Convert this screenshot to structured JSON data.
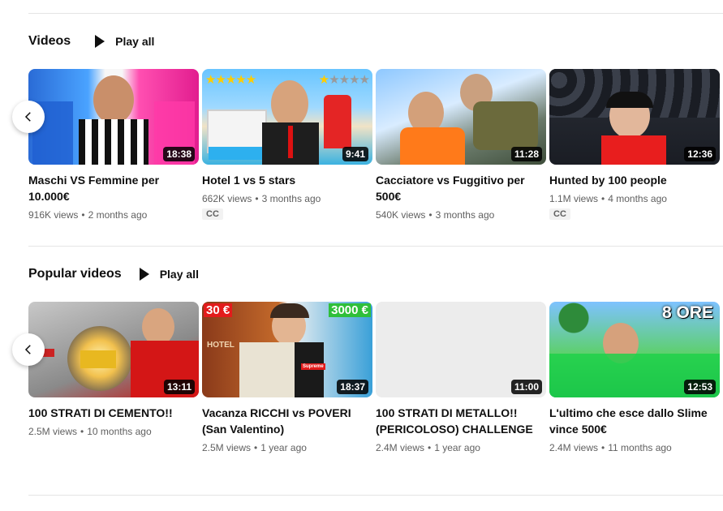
{
  "shelves": [
    {
      "title": "Videos",
      "play_all": "Play all",
      "videos": [
        {
          "title_line1": "Maschi VS Femmine per",
          "title_line2": "10.000€",
          "views": "916K views",
          "age": "2 months ago",
          "duration": "18:38",
          "cc": ""
        },
        {
          "title_line1": "Hotel 1 vs 5 stars",
          "title_line2": "",
          "views": "662K views",
          "age": "3 months ago",
          "duration": "9:41",
          "cc": "CC"
        },
        {
          "title_line1": "Cacciatore vs Fuggitivo per",
          "title_line2": "500€",
          "views": "540K views",
          "age": "3 months ago",
          "duration": "11:28",
          "cc": ""
        },
        {
          "title_line1": "Hunted by 100 people",
          "title_line2": "",
          "views": "1.1M views",
          "age": "4 months ago",
          "duration": "12:36",
          "cc": "CC"
        }
      ]
    },
    {
      "title": "Popular videos",
      "play_all": "Play all",
      "videos": [
        {
          "title_line1": "100 STRATI DI CEMENTO!!",
          "title_line2": "",
          "views": "2.5M views",
          "age": "10 months ago",
          "duration": "13:11",
          "cc": ""
        },
        {
          "title_line1": "Vacanza RICCHI vs POVERI",
          "title_line2": "(San Valentino)",
          "views": "2.5M views",
          "age": "1 year ago",
          "duration": "18:37",
          "cc": ""
        },
        {
          "title_line1": "100 STRATI DI METALLO!!",
          "title_line2": "(PERICOLOSO) CHALLENGE",
          "views": "2.4M views",
          "age": "1 year ago",
          "duration": "11:00",
          "cc": ""
        },
        {
          "title_line1": "L'ultimo che esce dallo Slime",
          "title_line2": "vince 500€",
          "views": "2.4M views",
          "age": "11 months ago",
          "duration": "12:53",
          "cc": ""
        }
      ]
    }
  ],
  "thumb_text": {
    "price_low": "30 €",
    "price_high": "3000 €",
    "hours": "8 ORE",
    "hotel_sign": "HOTEL",
    "brand": "Supreme"
  },
  "icons": {
    "play": "play-icon",
    "prev": "chevron-left-icon"
  }
}
